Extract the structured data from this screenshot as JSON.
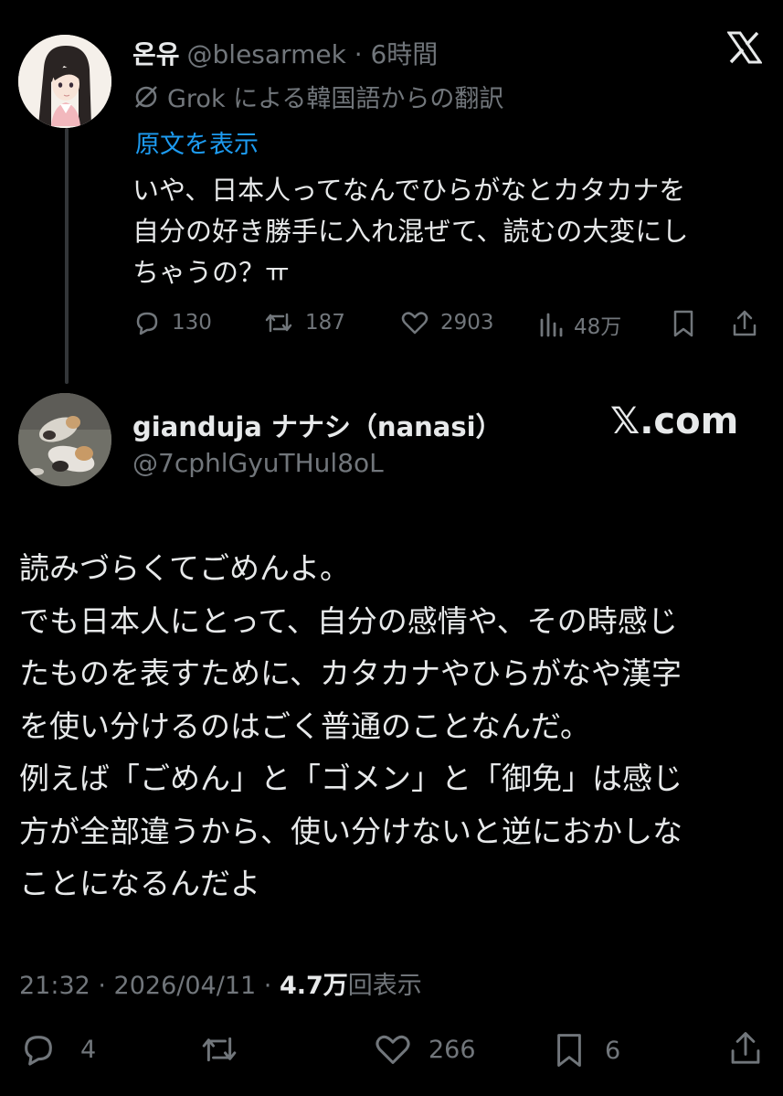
{
  "tweet1": {
    "display_name": "온유",
    "handle_time": "@blesarmek · 6時間",
    "translation_note": "Grok による韓国語からの翻訳",
    "show_original": "原文を表示",
    "text_lines": [
      "いや、日本人ってなんでひらがなとカタカナを",
      "自分の好き勝手に入れ混ぜて、読むの大変にし",
      "ちゃうの？ㅠ"
    ],
    "replies": "130",
    "reposts": "187",
    "likes": "2903",
    "views": "48万"
  },
  "tweet2": {
    "display_name": "gianduja ナナシ（nanasi）",
    "handle": "@7cphlGyuTHul8oL",
    "watermark": "𝕏.com",
    "text": "読みづらくてごめんよ。\nでも日本人にとって、自分の感情や、その時感じ\nたものを表すために、カタカナやひらがなや漢字\nを使い分けるのはごく普通のことなんだ。\n例えば「ごめん」と「ゴメン」と「御免」は感じ\n方が全部違うから、使い分けないと逆におかしな\nことになるんだよ",
    "timestamp": "21:32 · 2026/04/11 · ",
    "views_count": "4.7万",
    "views_label": "回表示",
    "replies": "4",
    "likes": "266",
    "bookmarks": "6"
  },
  "icons": {
    "x_logo": "x-logo-icon",
    "reply": "comment-bubble-icon",
    "repost": "repost-arrows-icon",
    "like": "heart-icon",
    "views": "bar-chart-icon",
    "bookmark": "bookmark-icon",
    "share": "share-upload-icon",
    "translate": "translate-slash-icon"
  },
  "colors": {
    "background": "#000000",
    "text": "#e7e9ea",
    "muted": "#71767b",
    "link": "#1d9bf0"
  }
}
